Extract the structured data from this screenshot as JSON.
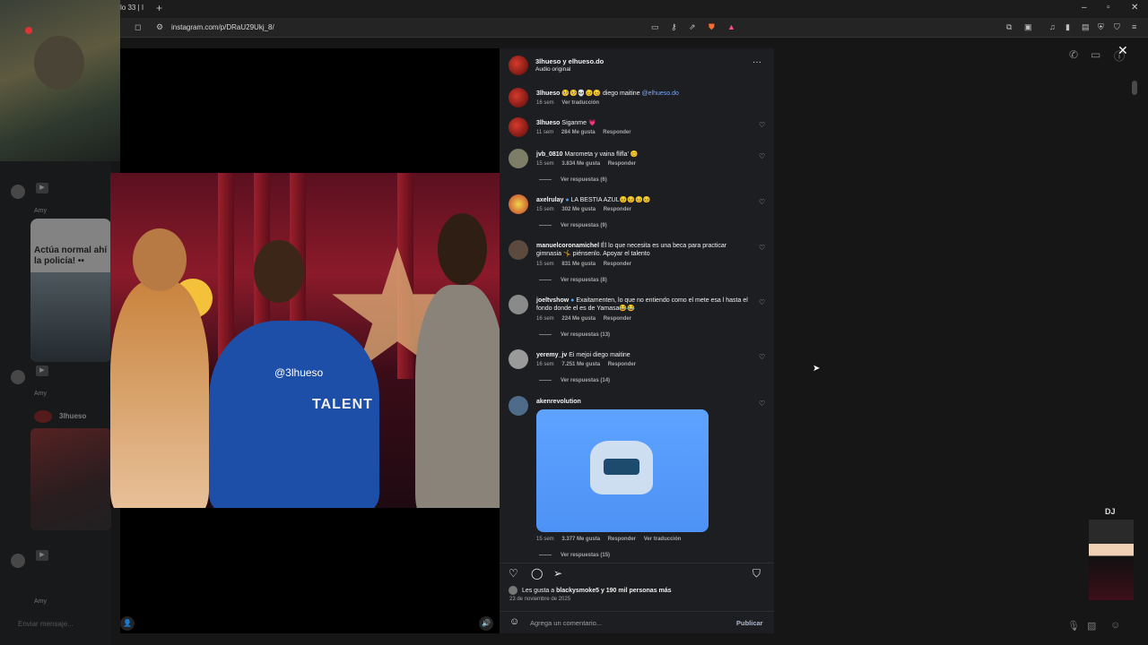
{
  "browser": {
    "tab_title": "lo 33 | I",
    "new_tab": "+",
    "url": "instagram.com/p/DRaU29Ukj_8/",
    "window_controls": [
      "–",
      "▫",
      "✕"
    ]
  },
  "background_chat": {
    "card_title": "Actúa normal ahí\nla policía! ••",
    "sender_name": "3lhueso",
    "meta_1": "Amy",
    "meta_2": "Amy",
    "meta_3": "Amy",
    "input_placeholder": "Enviar mensaje..."
  },
  "video": {
    "watermark": "@3lhueso",
    "sign_text": "TALENT"
  },
  "post": {
    "author": "3lhueso y elhueso.do",
    "audio": "Audio original",
    "more": "···",
    "caption": {
      "user": "3lhueso",
      "emoji": "🥺🥺💀😣😣",
      "text": "diego maitine",
      "mention": "@elhueso.do",
      "time": "16 sem",
      "translate": "Ver traducción"
    },
    "comments": [
      {
        "user": "3lhueso",
        "text": "Siganme 💗",
        "time": "11 sem",
        "likes": "284 Me gusta",
        "reply": "Responder",
        "replies": ""
      },
      {
        "user": "jvb_0810",
        "text": "Marometa y vaina flifla' 😊",
        "time": "15 sem",
        "likes": "3.834 Me gusta",
        "reply": "Responder",
        "replies": "Ver respuestas (6)"
      },
      {
        "user": "axelrulay",
        "text": "LA BESTIA AZUL😣😣😣😣",
        "time": "15 sem",
        "likes": "302 Me gusta",
        "reply": "Responder",
        "replies": "Ver respuestas (9)"
      },
      {
        "user": "manuelcoronamichel",
        "text": "Él lo que necesita es una beca para practicar gimnasia 🤸 piénsenlo. Apoyar el talento",
        "time": "15 sem",
        "likes": "831 Me gusta",
        "reply": "Responder",
        "replies": "Ver respuestas (8)"
      },
      {
        "user": "joeltvshow",
        "text": "Exaitamenten, lo que no entiendo como el mete esa l hasta el fondo donde el es de Yamasa😂😂",
        "time": "16 sem",
        "likes": "224 Me gusta",
        "reply": "Responder",
        "replies": "Ver respuestas (13)"
      },
      {
        "user": "yeremy_jv",
        "text": "Ei mejoi diego maitine",
        "time": "16 sem",
        "likes": "7.251 Me gusta",
        "reply": "Responder",
        "replies": "Ver respuestas (14)"
      },
      {
        "user": "akenrevolution",
        "text": "",
        "time": "15 sem",
        "likes": "3.377 Me gusta",
        "reply": "Responder",
        "translate": "Ver traducción",
        "replies": "Ver respuestas (15)"
      }
    ],
    "likes_line_prefix": "Les gusta a",
    "likes_line_user": "blackysmoke5",
    "likes_line_suffix": "y 190 mil personas más",
    "date": "23 de noviembre de 2025",
    "comment_placeholder": "Agrega un comentario...",
    "publish": "Publicar"
  },
  "overlay": {
    "pixel_label": "DJ"
  },
  "icons": {
    "close": "close-icon",
    "heart": "heart-icon",
    "comment": "comment-icon",
    "share": "share-icon",
    "bookmark": "bookmark-icon",
    "emoji": "emoji-icon"
  },
  "colors": {
    "panel_bg": "#1c1e21",
    "mention": "#7da7ff",
    "gif_bg": "#5ea3ff"
  }
}
